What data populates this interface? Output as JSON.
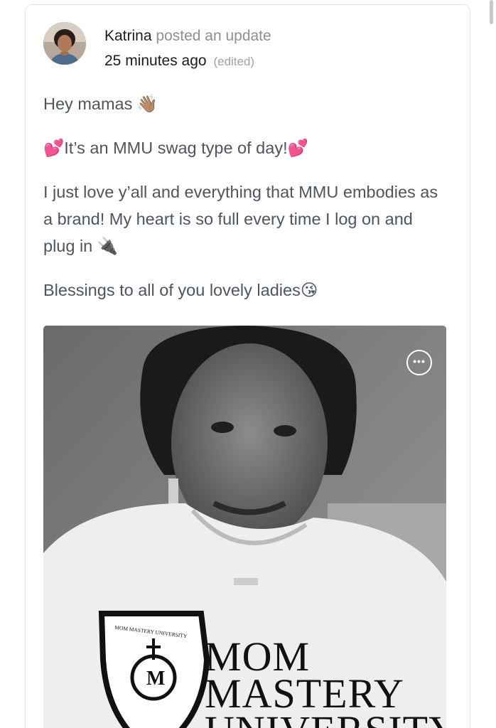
{
  "post": {
    "author": "Katrina",
    "action": "posted an update",
    "timestamp": "25 minutes ago",
    "edited_label": "(edited)",
    "paragraphs": [
      {
        "text": "Hey mamas",
        "emoji_after": "👋🏽"
      },
      {
        "emoji_before": "💕",
        "text": "It’s an MMU swag type of day!",
        "emoji_after": "💕"
      },
      {
        "text": "I just love y’all and everything that MMU embodies as a brand! My heart is so full every time I log on and plug in",
        "emoji_after": "🔌"
      },
      {
        "text": "Blessings to all of you lovely ladies",
        "emoji_after": "😘"
      }
    ]
  },
  "media": {
    "more_icon": "more-horizontal-icon",
    "shirt_lines": [
      "MOM",
      "MASTERY",
      "UNIVERSITY"
    ],
    "crest_text": "MOM MASTERY UNIVERSITY"
  },
  "icons": {
    "avatar": "avatar-photo"
  }
}
